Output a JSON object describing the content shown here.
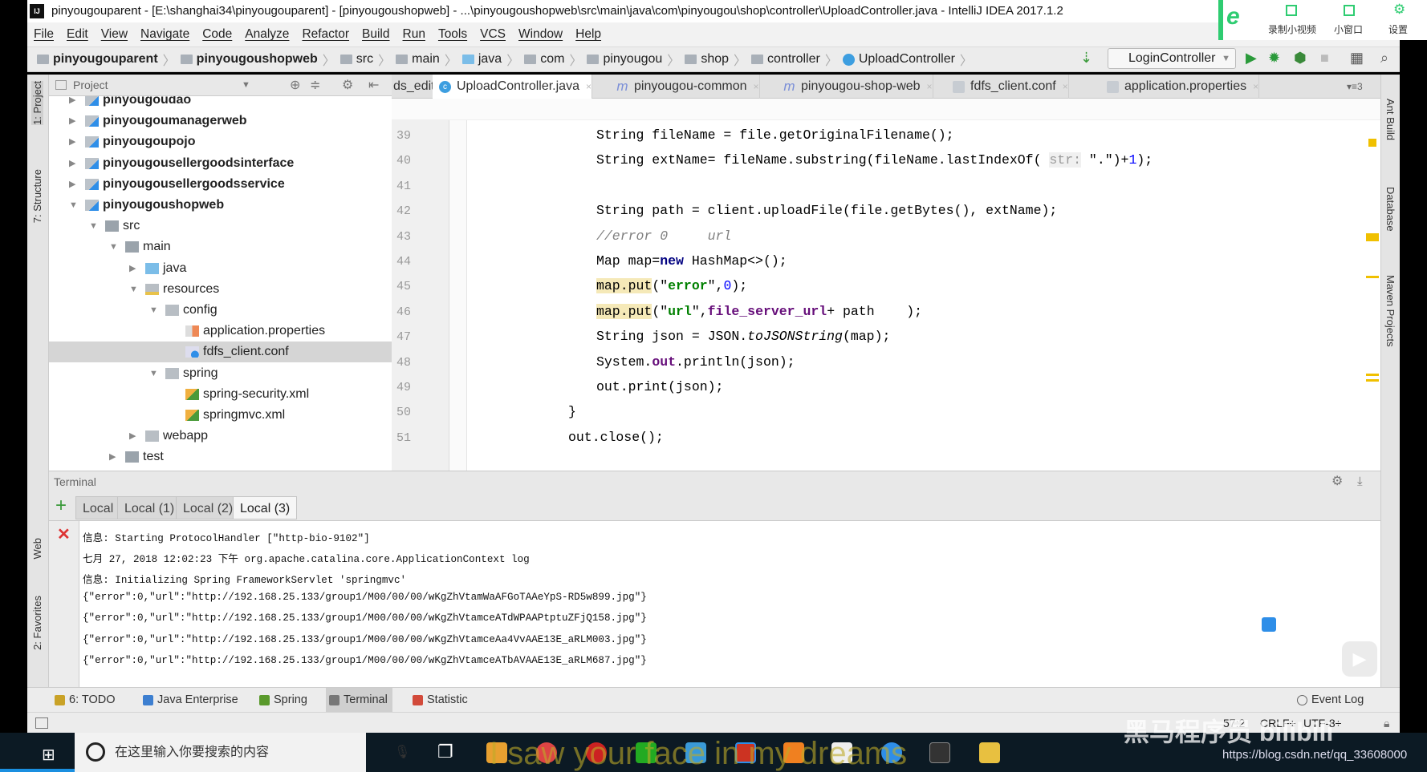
{
  "window": {
    "title": "pinyougouparent - [E:\\shanghai34\\pinyougouparent] - [pinyougoushopweb] - ...\\pinyougoushopweb\\src\\main\\java\\com\\pinyougou\\shop\\controller\\UploadController.java - IntelliJ IDEA 2017.1.2",
    "app_icon": "IJ"
  },
  "menu": [
    "File",
    "Edit",
    "View",
    "Navigate",
    "Code",
    "Analyze",
    "Refactor",
    "Build",
    "Run",
    "Tools",
    "VCS",
    "Window",
    "Help"
  ],
  "breadcrumb": [
    "pinyougouparent",
    "pinyougoushopweb",
    "src",
    "main",
    "java",
    "com",
    "pinyougou",
    "shop",
    "controller",
    "UploadController"
  ],
  "toolbar": {
    "run_config": "LoginController"
  },
  "left_strip": [
    "1: Project",
    "7: Structure",
    "Web",
    "2: Favorites"
  ],
  "right_strip": [
    "Ant Build",
    "Database",
    "Maven Projects"
  ],
  "project": {
    "title": "Project",
    "tree": [
      {
        "label": "pinyougoudao",
        "level": 0,
        "arrow": "right",
        "icon": "mod",
        "bold": true
      },
      {
        "label": "pinyougoumanagerweb",
        "level": 0,
        "arrow": "right",
        "icon": "mod",
        "bold": true
      },
      {
        "label": "pinyougoupojo",
        "level": 0,
        "arrow": "right",
        "icon": "mod",
        "bold": true
      },
      {
        "label": "pinyougousellergoodsinterface",
        "level": 0,
        "arrow": "right",
        "icon": "mod",
        "bold": true
      },
      {
        "label": "pinyougousellergoodsservice",
        "level": 0,
        "arrow": "right",
        "icon": "mod",
        "bold": true
      },
      {
        "label": "pinyougoushopweb",
        "level": 0,
        "arrow": "down",
        "icon": "mod",
        "bold": true
      },
      {
        "label": "src",
        "level": 1,
        "arrow": "down",
        "icon": "src"
      },
      {
        "label": "main",
        "level": 2,
        "arrow": "down",
        "icon": "src"
      },
      {
        "label": "java",
        "level": 3,
        "arrow": "right",
        "icon": "java"
      },
      {
        "label": "resources",
        "level": 3,
        "arrow": "down",
        "icon": "res"
      },
      {
        "label": "config",
        "level": 4,
        "arrow": "down",
        "icon": "folder"
      },
      {
        "label": "application.properties",
        "level": 5,
        "arrow": "",
        "icon": "props"
      },
      {
        "label": "fdfs_client.conf",
        "level": 5,
        "arrow": "",
        "icon": "conf",
        "selected": true
      },
      {
        "label": "spring",
        "level": 4,
        "arrow": "down",
        "icon": "folder"
      },
      {
        "label": "spring-security.xml",
        "level": 5,
        "arrow": "",
        "icon": "xml"
      },
      {
        "label": "springmvc.xml",
        "level": 5,
        "arrow": "",
        "icon": "xml"
      },
      {
        "label": "webapp",
        "level": 3,
        "arrow": "right",
        "icon": "folder"
      },
      {
        "label": "test",
        "level": 2,
        "arrow": "right",
        "icon": "src"
      }
    ]
  },
  "editor_tabs": [
    {
      "label": "ds_edit.html",
      "icon": "file"
    },
    {
      "label": "UploadController.java",
      "icon": "class",
      "active": true
    },
    {
      "label": "pinyougou-common",
      "icon": "maven"
    },
    {
      "label": "pinyougou-shop-web",
      "icon": "maven"
    },
    {
      "label": "fdfs_client.conf",
      "icon": "file"
    },
    {
      "label": "application.properties",
      "icon": "file"
    }
  ],
  "tabs_overflow": "▾≡3",
  "code": [
    {
      "n": "39",
      "indent": 1,
      "tokens": [
        [
          "String fileName = file.getOriginalFilename();",
          ""
        ]
      ]
    },
    {
      "n": "40",
      "indent": 1,
      "tokens": [
        [
          "String extName= fileName.substring(fileName.lastIndexOf( ",
          ""
        ],
        [
          "str:",
          "hint"
        ],
        [
          " \".\")+",
          ""
        ],
        [
          "1",
          "num"
        ],
        [
          ");",
          ""
        ]
      ]
    },
    {
      "n": "41",
      "indent": 1,
      "tokens": []
    },
    {
      "n": "42",
      "indent": 1,
      "tokens": [
        [
          "String path = client.uploadFile(file.getBytes(), extName);",
          ""
        ]
      ]
    },
    {
      "n": "43",
      "indent": 1,
      "tokens": [
        [
          "//error 0     url",
          "cm"
        ]
      ]
    },
    {
      "n": "44",
      "indent": 1,
      "tokens": [
        [
          "Map map=",
          ""
        ],
        [
          "new",
          "kw"
        ],
        [
          " HashMap<>();",
          ""
        ]
      ]
    },
    {
      "n": "45",
      "indent": 1,
      "tokens": [
        [
          "map.put",
          "hl"
        ],
        [
          "(\"",
          ""
        ],
        [
          "error",
          "str"
        ],
        [
          "\",",
          ""
        ],
        [
          "0",
          "num"
        ],
        [
          ");",
          ""
        ]
      ]
    },
    {
      "n": "46",
      "indent": 1,
      "tokens": [
        [
          "map.put",
          "hl"
        ],
        [
          "(\"",
          ""
        ],
        [
          "url",
          "str"
        ],
        [
          "\",",
          ""
        ],
        [
          "file_server_url",
          "field"
        ],
        [
          "+ path    );",
          ""
        ]
      ]
    },
    {
      "n": "47",
      "indent": 1,
      "tokens": [
        [
          "String json = JSON.",
          ""
        ],
        [
          "toJSONString",
          "it"
        ],
        [
          "(map);",
          ""
        ]
      ]
    },
    {
      "n": "48",
      "indent": 1,
      "tokens": [
        [
          "System.",
          ""
        ],
        [
          "out",
          "field"
        ],
        [
          ".println(json);",
          ""
        ]
      ]
    },
    {
      "n": "49",
      "indent": 1,
      "tokens": [
        [
          "out.print(json);",
          ""
        ]
      ]
    },
    {
      "n": "50",
      "indent": 0,
      "tokens": [
        [
          "}",
          ""
        ]
      ]
    },
    {
      "n": "51",
      "indent": 0,
      "tokens": [
        [
          "out.close();",
          ""
        ]
      ]
    }
  ],
  "terminal": {
    "title": "Terminal",
    "tabs": [
      "Local",
      "Local (1)",
      "Local (2)",
      "Local (3)"
    ],
    "active_tab": 3,
    "lines": [
      "信息: Starting ProtocolHandler [\"http-bio-9102\"]",
      "七月 27, 2018 12:02:23 下午 org.apache.catalina.core.ApplicationContext log",
      "信息: Initializing Spring FrameworkServlet 'springmvc'",
      "{\"error\":0,\"url\":\"http://192.168.25.133/group1/M00/00/00/wKgZhVtamWaAFGoTAAeYpS-RD5w899.jpg\"}",
      "{\"error\":0,\"url\":\"http://192.168.25.133/group1/M00/00/00/wKgZhVtamceATdWPAAPtptuZFjQ158.jpg\"}",
      "{\"error\":0,\"url\":\"http://192.168.25.133/group1/M00/00/00/wKgZhVtamceAa4VvAAE13E_aRLM003.jpg\"}",
      "{\"error\":0,\"url\":\"http://192.168.25.133/group1/M00/00/00/wKgZhVtamceATbAVAAE13E_aRLM687.jpg\"}"
    ]
  },
  "bottom_tools": [
    {
      "label": "6: TODO",
      "color": "#c9a227"
    },
    {
      "label": "Java Enterprise",
      "color": "#3d7fd0"
    },
    {
      "label": "Spring",
      "color": "#5a9a2c"
    },
    {
      "label": "Terminal",
      "color": "#777",
      "active": true
    },
    {
      "label": "Statistic",
      "color": "#d24a3a"
    }
  ],
  "event_log": "Event Log",
  "status": {
    "position": "57:2",
    "line_sep": "CRLF÷",
    "encoding": "UTF-8÷"
  },
  "overlay": {
    "record": "录制小视频",
    "mini": "小窗口",
    "settings": "设置"
  },
  "taskbar": {
    "search_placeholder": "在这里输入你要搜索的内容"
  },
  "video": {
    "watermark": "黑马程序员 bilibili",
    "url": "https://blog.csdn.net/qq_33608000",
    "lyric": "I saw your face in my dreams"
  }
}
